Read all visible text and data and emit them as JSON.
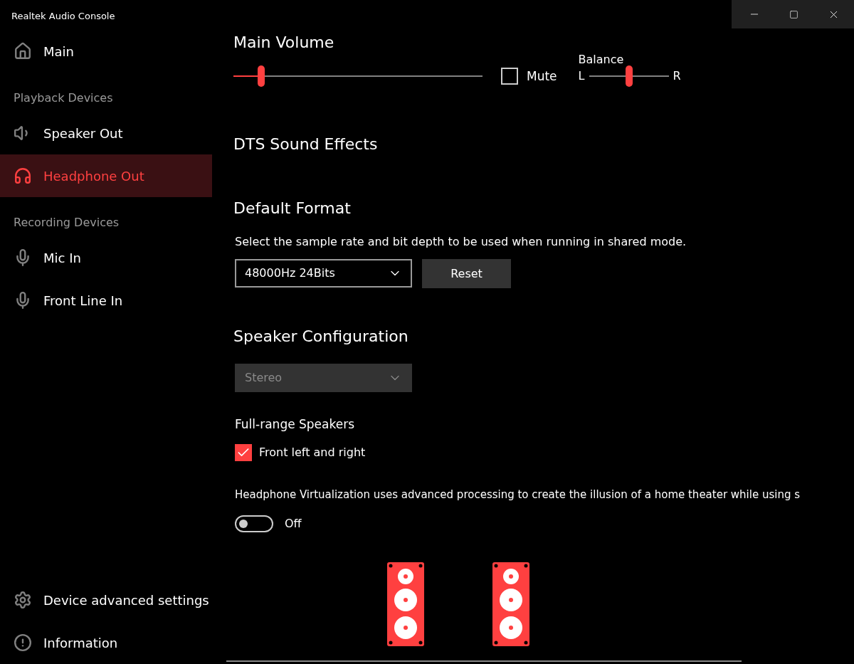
{
  "window": {
    "title": "Realtek Audio Console"
  },
  "nav": [
    {
      "kind": "home",
      "label": "Main",
      "selected": false
    },
    {
      "kind": "header",
      "label": "Playback Devices"
    },
    {
      "kind": "speaker",
      "label": "Speaker Out",
      "selected": false
    },
    {
      "kind": "headphones",
      "label": "Headphone Out",
      "selected": true
    },
    {
      "kind": "header",
      "label": "Recording Devices"
    },
    {
      "kind": "mic",
      "label": "Mic In",
      "selected": false
    },
    {
      "kind": "mic",
      "label": "Front Line In",
      "selected": false
    }
  ],
  "footer_nav": [
    {
      "kind": "gear",
      "label": "Device advanced settings",
      "selected": false
    },
    {
      "kind": "info",
      "label": "Information",
      "selected": false
    }
  ],
  "main_volume": {
    "title": "Main Volume",
    "level": 0.11,
    "mute": {
      "label": "Mute",
      "checked": false
    },
    "balance": {
      "label": "Balance",
      "left": "L",
      "right": "R",
      "level": 0.5
    }
  },
  "dts": {
    "title": "DTS Sound Effects"
  },
  "default_format": {
    "title": "Default Format",
    "description": "Select the sample rate and bit depth to be used when running in shared mode.",
    "value": "48000Hz 24Bits",
    "button": "Reset"
  },
  "speaker_configuration": {
    "title": "Speaker Configuration",
    "value": "Stereo",
    "disabled": true,
    "full_range_title": "Full-range Speakers",
    "full_range": {
      "label": "Front left and right",
      "checked": true
    },
    "virtualization_text": "Headphone Virtualization uses advanced processing to create the illusion of a home theater while using s",
    "virtualization": {
      "label": "Off",
      "on": false
    }
  }
}
